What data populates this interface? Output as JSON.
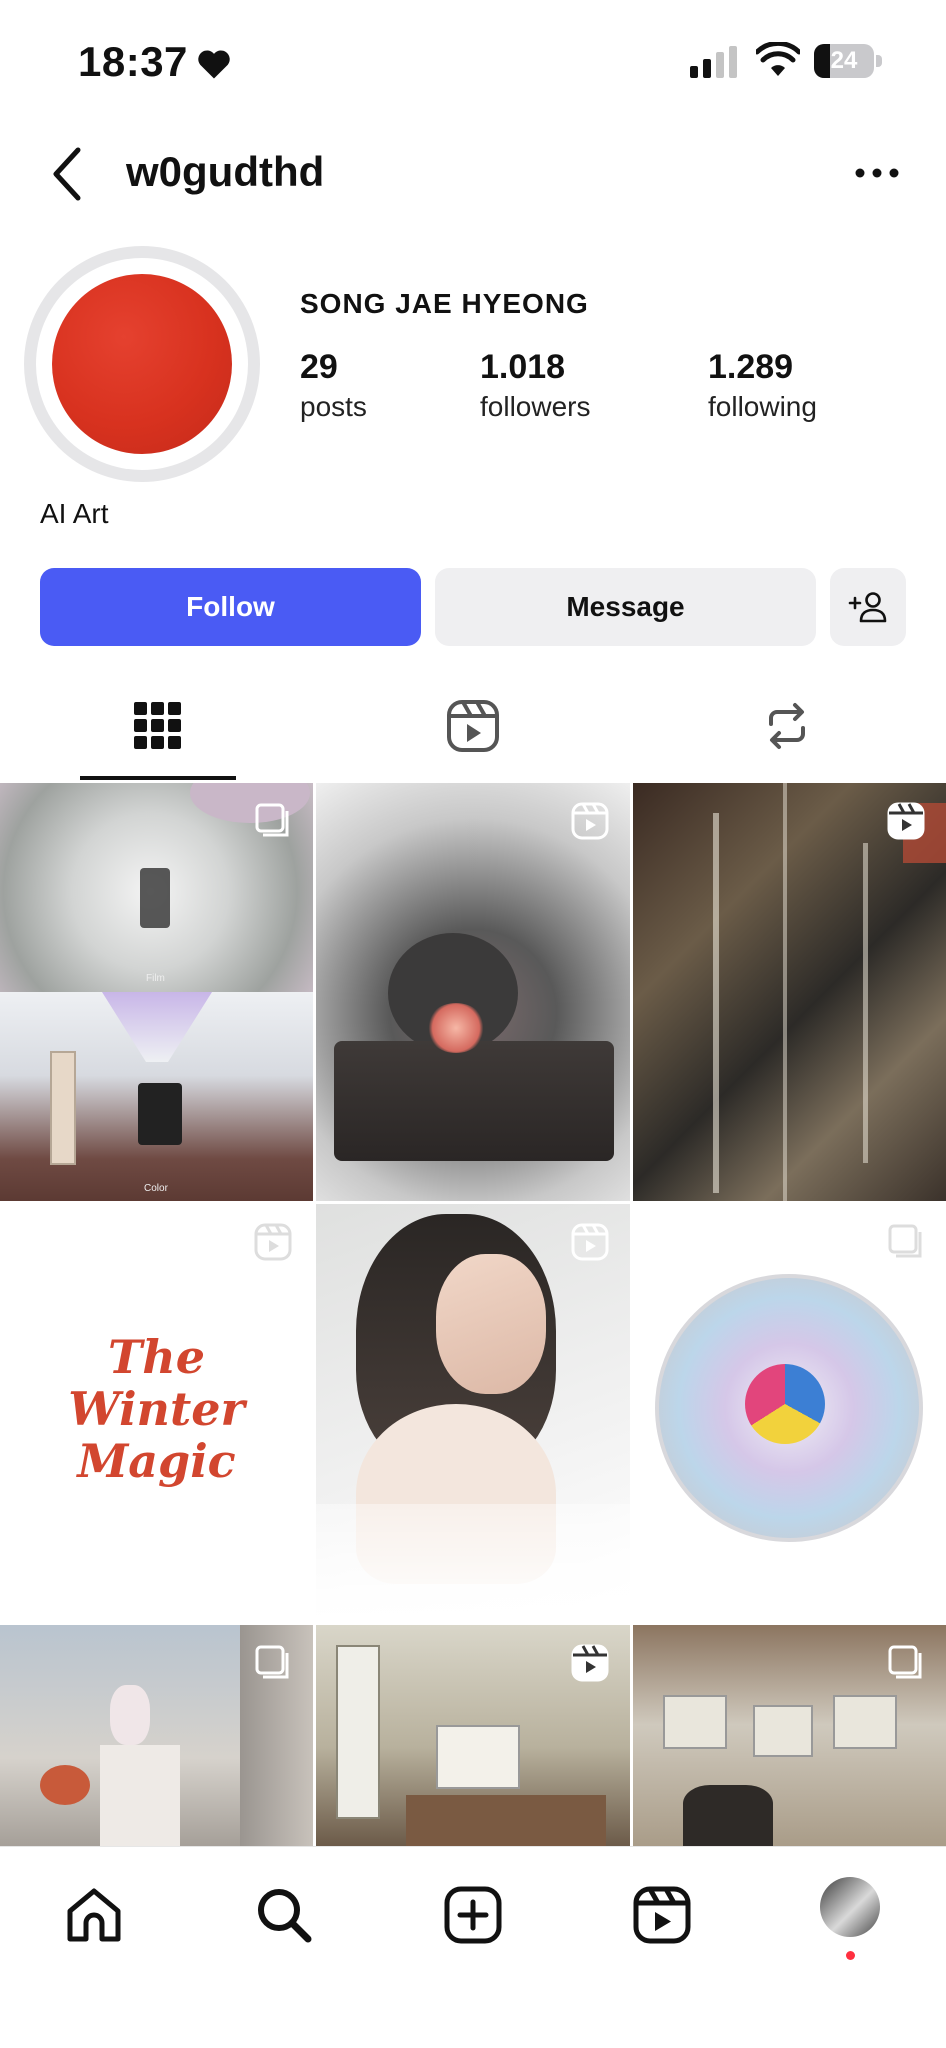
{
  "status_bar": {
    "time": "18:37",
    "battery": "24"
  },
  "header": {
    "username": "w0gudthd"
  },
  "profile": {
    "display_name": "SONG JAE HYEONG",
    "stats": [
      {
        "value": "29",
        "label": "posts"
      },
      {
        "value": "1.018",
        "label": "followers"
      },
      {
        "value": "1.289",
        "label": "following"
      }
    ],
    "bio": "AI Art"
  },
  "actions": {
    "follow_label": "Follow",
    "message_label": "Message"
  },
  "tabs": [
    "grid-icon",
    "reels-icon",
    "reposts-icon"
  ],
  "grid": {
    "posts": [
      {
        "type": "carousel",
        "top_caption": "Film",
        "bottom_caption": "Color"
      },
      {
        "type": "reel"
      },
      {
        "type": "reel"
      },
      {
        "type": "reel",
        "art_text": "The Winter Magic"
      },
      {
        "type": "reel"
      },
      {
        "type": "carousel"
      },
      {
        "type": "carousel"
      },
      {
        "type": "reel"
      },
      {
        "type": "carousel"
      }
    ]
  },
  "bottom_nav": [
    "home-icon",
    "search-icon",
    "create-icon",
    "reels-icon",
    "profile-avatar"
  ],
  "colors": {
    "follow_button": "#4a5bf4",
    "secondary_button": "#efeff1",
    "notification_dot": "#ff3040"
  }
}
